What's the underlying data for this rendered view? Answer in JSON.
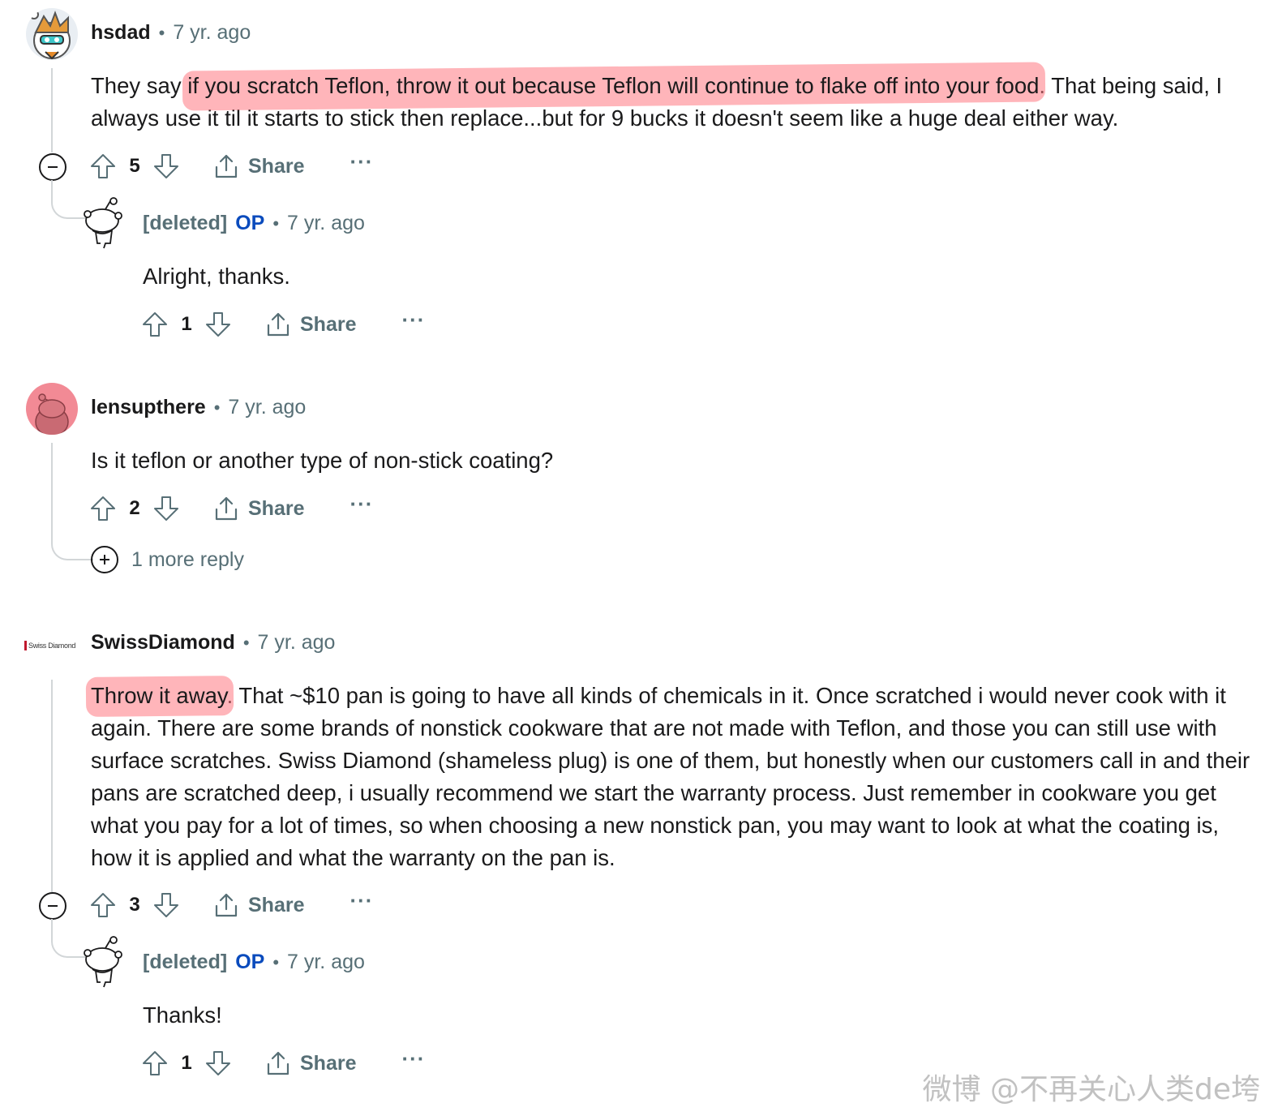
{
  "comments": [
    {
      "author": "hsdad",
      "time": "7 yr. ago",
      "body_pre": "They say ",
      "body_highlight": "if you scratch Teflon, throw it out because Teflon will continue to flake off into your food",
      "body_post": ". That being said, I always use it til it starts to stick then replace...but for 9 bucks it doesn't seem like a huge deal either way.",
      "score": "5",
      "share": "Share",
      "more": "···",
      "reply": {
        "author": "[deleted]",
        "op": "OP",
        "time": "7 yr. ago",
        "body": "Alright, thanks.",
        "score": "1",
        "share": "Share",
        "more": "···"
      }
    },
    {
      "author": "lensupthere",
      "time": "7 yr. ago",
      "body": "Is it teflon or another type of non-stick coating?",
      "score": "2",
      "share": "Share",
      "more": "···",
      "more_replies": "1 more reply"
    },
    {
      "author": "SwissDiamond",
      "avatar_text": "Swiss Diamond",
      "time": "7 yr. ago",
      "body_highlight": "Throw it away",
      "body_post": ". That ~$10 pan is going to have all kinds of chemicals in it. Once scratched i would never cook with it again. There are some brands of nonstick cookware that are not made with Teflon, and those you can still use with surface scratches. Swiss Diamond (shameless plug) is one of them, but honestly when our customers call in and their pans are scratched deep, i usually recommend we start the warranty process. Just remember in cookware you get what you pay for a lot of times, so when choosing a new nonstick pan, you may want to look at what the coating is, how it is applied and what the warranty on the pan is.",
      "score": "3",
      "share": "Share",
      "more": "···",
      "reply": {
        "author": "[deleted]",
        "op": "OP",
        "time": "7 yr. ago",
        "body": "Thanks!",
        "score": "1",
        "share": "Share",
        "more": "···"
      }
    }
  ],
  "watermark": "微博 @不再关心人类de垮",
  "colors": {
    "text": "#1a1a1b",
    "meta": "#576f76",
    "op": "#0a4bbd",
    "thread_line": "#d2d6d8",
    "highlight": "#ff7882",
    "avatar_pink": "#f28a95"
  },
  "icons": [
    "upvote-icon",
    "downvote-icon",
    "share-icon",
    "collapse-icon",
    "expand-icon",
    "more-options-icon"
  ]
}
